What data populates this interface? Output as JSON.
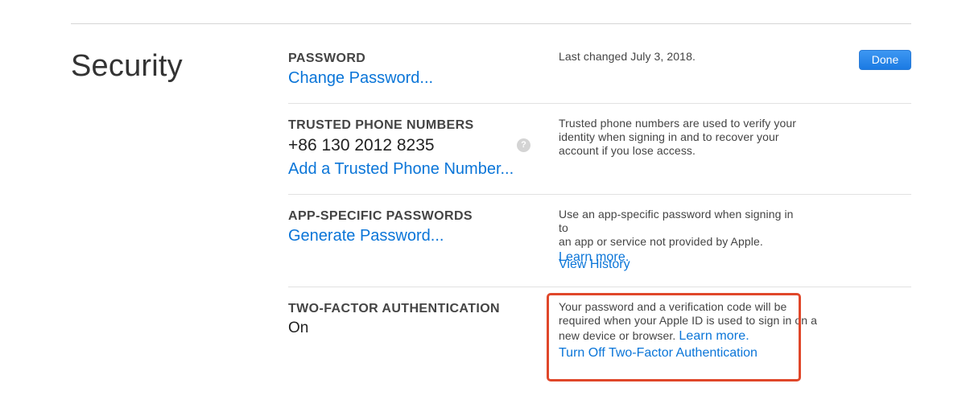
{
  "section": {
    "title": "Security",
    "done_label": "Done"
  },
  "password": {
    "label": "PASSWORD",
    "link": "Change Password...",
    "description": "Last changed July 3, 2018."
  },
  "trusted_phones": {
    "label": "TRUSTED PHONE NUMBERS",
    "number": "+86 130 2012 8235",
    "help_icon": "?",
    "add_link": "Add a Trusted Phone Number...",
    "description_lines": [
      "Trusted phone numbers are used to verify your",
      "identity when signing in and to recover your",
      "account if you lose access."
    ]
  },
  "app_passwords": {
    "label": "APP-SPECIFIC PASSWORDS",
    "link": "Generate Password...",
    "description_lines": [
      "Use an app-specific password when signing in to",
      "an app or service not provided by Apple."
    ],
    "learn_more": "Learn more.",
    "view_history": "View History"
  },
  "two_factor": {
    "label": "TWO-FACTOR AUTHENTICATION",
    "status": "On",
    "description_lines": [
      "Your password and a verification code will be",
      "required when your Apple ID is used to sign in on a",
      "new device or browser."
    ],
    "learn_more": "Learn more.",
    "turn_off": "Turn Off Two-Factor Authentication"
  },
  "colors": {
    "link": "#0a75d8",
    "done_button": "#1b7ae3",
    "highlight": "#e0472a"
  }
}
